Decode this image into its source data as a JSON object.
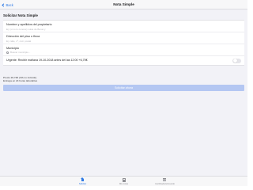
{
  "navbar": {
    "back_label": "Back",
    "title": "Nota Simple"
  },
  "section": {
    "title": "Solicitar Nota Simple"
  },
  "form": {
    "owner": {
      "label": "Nombre y apellidos del propietario",
      "placeholder": "Ej: (si no lo conoce) Luisa de Benet y"
    },
    "address": {
      "label": "Dirección del piso o finca",
      "placeholder": "Ej: calle, nº, cód. postal"
    },
    "municipality": {
      "label": "Municipio",
      "placeholder": "Buscar municipio..."
    },
    "urgent": {
      "label": "Urgente: Recibir mañana 19-10-2018 antes del las 12:00 +6,75€",
      "value": false
    }
  },
  "price": {
    "line1": "Precio 20,74€ (IVA no incluido)",
    "line2": "Entrega en 24 horas laborables"
  },
  "cta": {
    "label": "Solicitar ahora"
  },
  "tabbar": {
    "items": [
      {
        "label": "Solicitar",
        "icon": "home-icon",
        "active": true
      },
      {
        "label": "Mis notas",
        "icon": "document-icon",
        "active": false
      },
      {
        "label": "Certificado/s/Acuerdo",
        "icon": "list-icon",
        "active": false
      }
    ]
  },
  "colors": {
    "accent": "#2f7ae5",
    "cta_disabled": "#b4c7f2",
    "background": "#f2f2f7"
  }
}
